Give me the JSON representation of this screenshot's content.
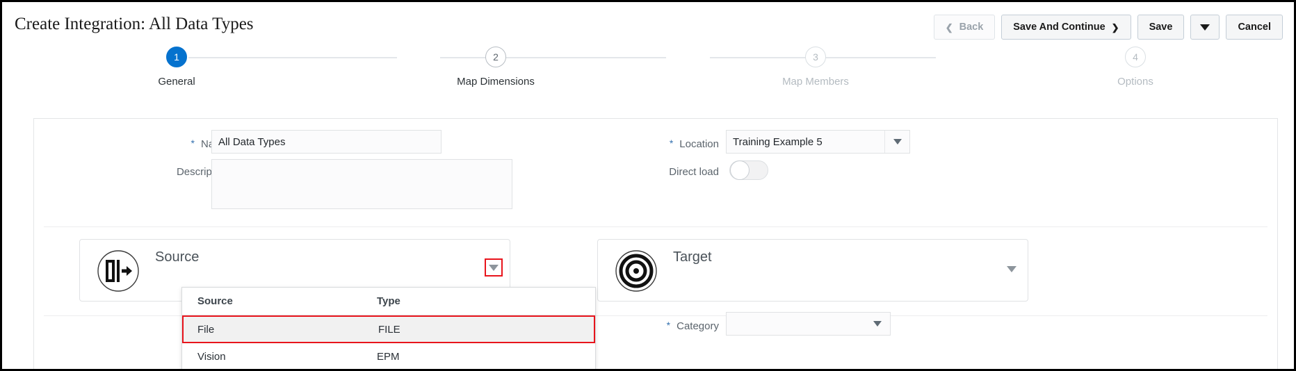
{
  "header": {
    "title": "Create Integration: All Data Types",
    "toolbar": {
      "back_label": "Back",
      "back_icon": "chevron-left-icon",
      "save_and_continue_label": "Save And Continue",
      "save_and_continue_icon": "chevron-right-icon",
      "save_label": "Save",
      "save_menu_icon": "caret-down-icon",
      "cancel_label": "Cancel"
    }
  },
  "stepper": {
    "steps": [
      {
        "number": "1",
        "label": "General",
        "state": "active"
      },
      {
        "number": "2",
        "label": "Map Dimensions",
        "state": "enabled"
      },
      {
        "number": "3",
        "label": "Map Members",
        "state": "disabled"
      },
      {
        "number": "4",
        "label": "Options",
        "state": "disabled"
      }
    ],
    "active_color": "#0572ce"
  },
  "form": {
    "required_marker": "*",
    "name": {
      "label": "Name",
      "value": "All Data Types",
      "placeholder": ""
    },
    "description": {
      "label": "Description",
      "value": "",
      "placeholder": ""
    },
    "location": {
      "label": "Location",
      "value": "Training Example 5",
      "dropdown_icon": "caret-down-icon"
    },
    "direct_load": {
      "label": "Direct load",
      "state": "off"
    },
    "category": {
      "label": "Category",
      "value": "",
      "dropdown_icon": "caret-down-icon"
    }
  },
  "source_card": {
    "title": "Source",
    "icon": "data-export-icon",
    "dropdown_icon": "caret-down-icon",
    "highlight_color": "#e8141c"
  },
  "target_card": {
    "title": "Target",
    "icon": "bullseye-target-icon",
    "dropdown_icon": "caret-down-icon"
  },
  "source_dropdown": {
    "columns": [
      "Source",
      "Type"
    ],
    "rows": [
      {
        "source": "File",
        "type": "FILE",
        "selected": true
      },
      {
        "source": "Vision",
        "type": "EPM",
        "selected": false
      }
    ]
  }
}
